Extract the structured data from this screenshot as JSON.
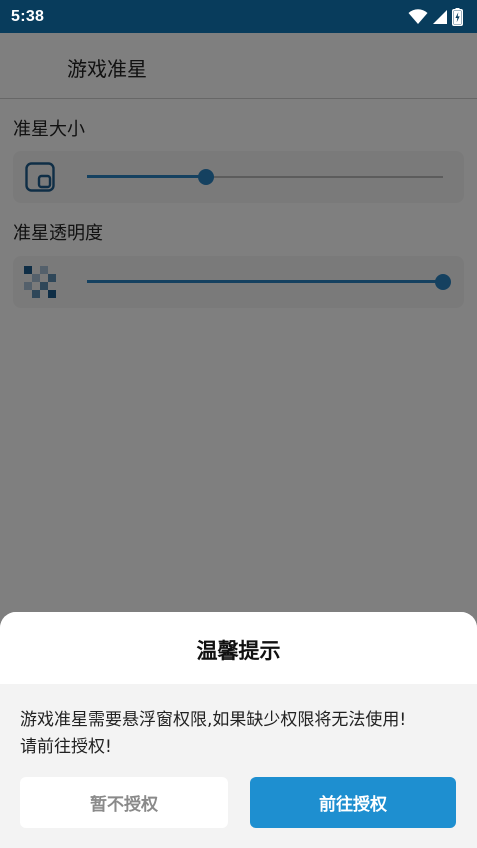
{
  "status_bar": {
    "time": "5:38",
    "icons": [
      "wifi-icon",
      "signal-icon",
      "battery-charging-icon"
    ]
  },
  "app_bar": {
    "title": "游戏准星"
  },
  "settings": {
    "size": {
      "label": "准星大小",
      "icon": "crosshair-size-icon",
      "value_fraction": 0.335
    },
    "opacity": {
      "label": "准星透明度",
      "icon": "checkerboard-opacity-icon",
      "value_fraction": 1.0
    }
  },
  "dialog": {
    "title": "温馨提示",
    "message_line1": "游戏准星需要悬浮窗权限,如果缺少权限将无法使用!",
    "message_line2": "请前往授权!",
    "deny_label": "暂不授权",
    "grant_label": "前往授权"
  },
  "colors": {
    "status_bar": "#083c5c",
    "accent": "#2a82c0",
    "grant_button": "#1e8fd0"
  }
}
